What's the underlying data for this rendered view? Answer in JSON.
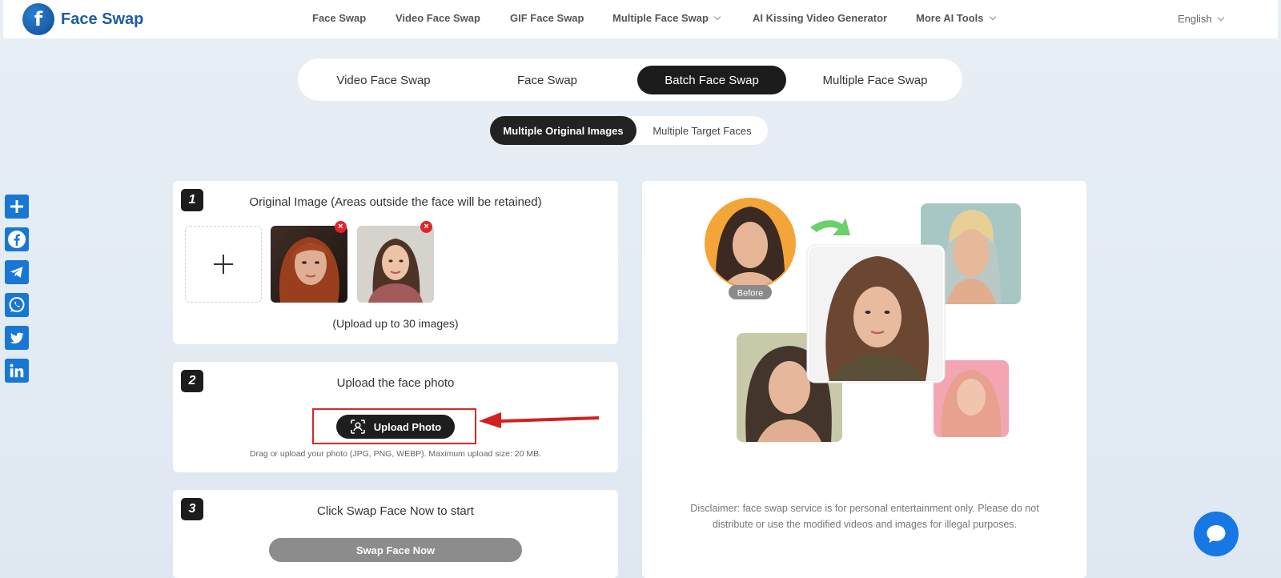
{
  "header": {
    "logo_text": "Face Swap",
    "nav": [
      {
        "label": "Face Swap"
      },
      {
        "label": "Video Face Swap"
      },
      {
        "label": "GIF Face Swap"
      },
      {
        "label": "Multiple Face Swap",
        "dropdown": true
      },
      {
        "label": "AI Kissing Video Generator"
      },
      {
        "label": "More AI Tools",
        "dropdown": true
      }
    ],
    "language": "English"
  },
  "main_tabs": [
    {
      "label": "Video Face Swap",
      "active": false
    },
    {
      "label": "Face Swap",
      "active": false
    },
    {
      "label": "Batch Face Swap",
      "active": true
    },
    {
      "label": "Multiple Face Swap",
      "active": false
    }
  ],
  "sub_tabs": [
    {
      "label": "Multiple Original Images",
      "active": true
    },
    {
      "label": "Multiple Target Faces",
      "active": false
    }
  ],
  "social_icons": [
    "share-icon",
    "facebook-icon",
    "telegram-icon",
    "whatsapp-icon",
    "twitter-icon",
    "linkedin-icon"
  ],
  "step1": {
    "number": "1",
    "title": "Original Image (Areas outside the face will be retained)",
    "limit_text": "(Upload up to 30 images)"
  },
  "step2": {
    "number": "2",
    "title": "Upload the face photo",
    "button_label": "Upload Photo",
    "hint": "Drag or upload your photo (JPG, PNG, WEBP). Maximum upload size: 20 MB."
  },
  "step3": {
    "number": "3",
    "title": "Click Swap Face Now to start",
    "button_label": "Swap Face Now"
  },
  "preview": {
    "before_label": "Before",
    "disclaimer_line1": "Disclaimer: face swap service is for personal entertainment only. Please do not",
    "disclaimer_line2": "distribute or use the modified videos and images for illegal purposes."
  },
  "colors": {
    "accent_dark": "#1c1c1c",
    "brand_blue": "#1e5ba4",
    "remove_red": "#e0242a",
    "highlight_red": "#d62828",
    "chat_blue": "#1777e4"
  }
}
